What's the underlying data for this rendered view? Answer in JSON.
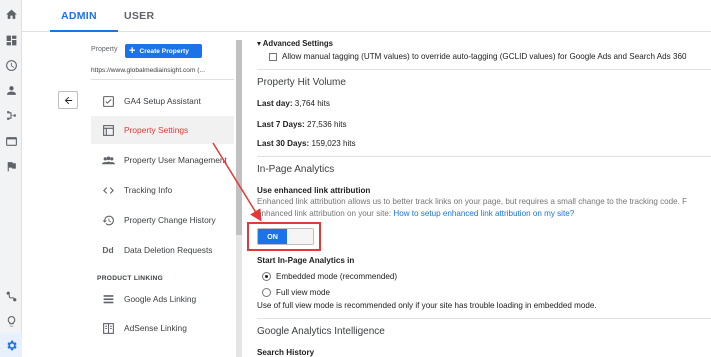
{
  "tabs": {
    "admin": "ADMIN",
    "user": "USER"
  },
  "property": {
    "label": "Property",
    "create_button": "Create Property",
    "url": "https://www.globalmediainsight.com (..."
  },
  "menu": [
    {
      "label": "GA4 Setup Assistant",
      "icon": "checkbox-icon"
    },
    {
      "label": "Property Settings",
      "icon": "property-settings-icon",
      "selected": true
    },
    {
      "label": "Property User Management",
      "icon": "users-icon"
    },
    {
      "label": "Tracking Info",
      "icon": "code-icon"
    },
    {
      "label": "Property Change History",
      "icon": "history-icon"
    },
    {
      "label": "Data Deletion Requests",
      "icon": "dd-icon",
      "icon_text": "Dd"
    },
    {
      "label": "Google Ads Linking",
      "icon": "google-ads-icon"
    },
    {
      "label": "AdSense Linking",
      "icon": "adsense-icon"
    }
  ],
  "product_linking": "PRODUCT LINKING",
  "settings": {
    "advanced_title": "Advanced Settings",
    "auto_tagging": "Allow manual tagging (UTM values) to override auto-tagging (GCLID values) for Google Ads and Search Ads 360",
    "hit_volume_title": "Property Hit Volume",
    "last_day_label": "Last day:",
    "last_day_value": "3,764 hits",
    "last7_label": "Last 7 Days:",
    "last7_value": "27,536 hits",
    "last30_label": "Last 30 Days:",
    "last30_value": "159,023 hits",
    "inpage_title": "In-Page Analytics",
    "enhanced_title": "Use enhanced link attribution",
    "enhanced_desc1": "Enhanced link attribution allows us to better track links on your page, but requires a small change to the tracking code. F",
    "enhanced_desc2": "enhanced link attribution on your site:",
    "enhanced_link": "How to setup enhanced link attribution on my site?",
    "toggle_on": "ON",
    "start_title": "Start In-Page Analytics in",
    "embedded": "Embedded mode (recommended)",
    "full_view": "Full view mode",
    "full_view_note": "Use of full view mode is recommended only if your site has trouble loading in embedded mode.",
    "intelligence_title": "Google Analytics Intelligence",
    "search_history": "Search History"
  },
  "colors": {
    "accent": "#1a73e8",
    "annotation": "#e53935"
  }
}
